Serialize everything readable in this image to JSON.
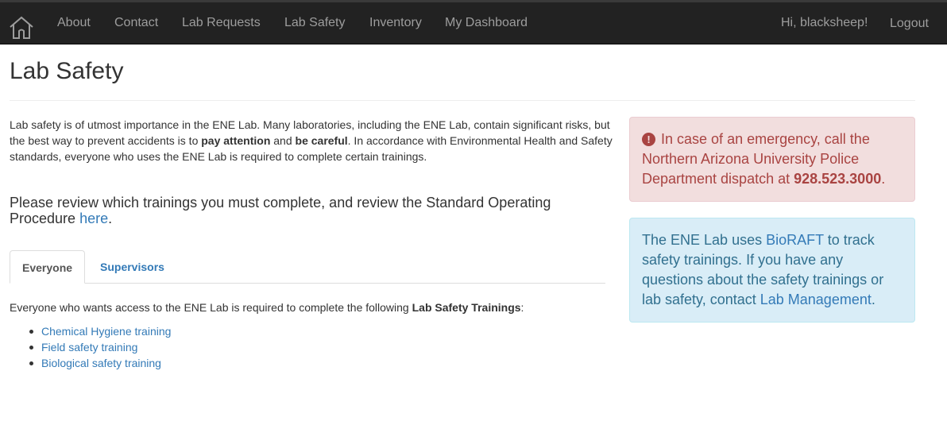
{
  "nav": {
    "home_icon": "home-icon",
    "items": [
      "About",
      "Contact",
      "Lab Requests",
      "Lab Safety",
      "Inventory",
      "My Dashboard"
    ],
    "greeting": "Hi, blacksheep!",
    "logout": "Logout"
  },
  "page": {
    "title": "Lab Safety",
    "intro": {
      "part1": "Lab safety is of utmost importance in the ENE Lab. Many laboratories, including the ENE Lab, contain significant risks, but the best way to prevent accidents is to ",
      "bold1": "pay attention",
      "part2": " and ",
      "bold2": "be careful",
      "part3": ". In accordance with Environmental Health and Safety standards, everyone who uses the ENE Lab is required to complete certain trainings."
    },
    "review": {
      "text": "Please review which trainings you must complete, and review the Standard Operating Procedure ",
      "link": "here",
      "end": "."
    }
  },
  "tabs": [
    {
      "label": "Everyone",
      "active": true
    },
    {
      "label": "Supervisors",
      "active": false
    }
  ],
  "everyone_tab": {
    "intro": "Everyone who wants access to the ENE Lab is required to complete the following ",
    "intro_bold": "Lab Safety Trainings",
    "intro_end": ":",
    "trainings": [
      "Chemical Hygiene training",
      "Field safety training",
      "Biological safety training"
    ]
  },
  "emergency_alert": {
    "icon": "exclamation-circle-icon",
    "text": "In case of an emergency, call the Northern Arizona University Police Department dispatch at ",
    "phone": "928.523.3000",
    "end": "."
  },
  "info_alert": {
    "part1": "The ENE Lab uses ",
    "link1": "BioRAFT",
    "part2": " to track safety trainings. If you have any questions about the safety trainings or lab safety, contact ",
    "link2": "Lab Management",
    "end": "."
  },
  "colors": {
    "navbar_bg": "#222222",
    "nav_text": "#9d9d9d",
    "link": "#337ab7",
    "danger_bg": "#f2dede",
    "danger_text": "#a94442",
    "info_bg": "#d9edf7",
    "info_text": "#31708f"
  }
}
